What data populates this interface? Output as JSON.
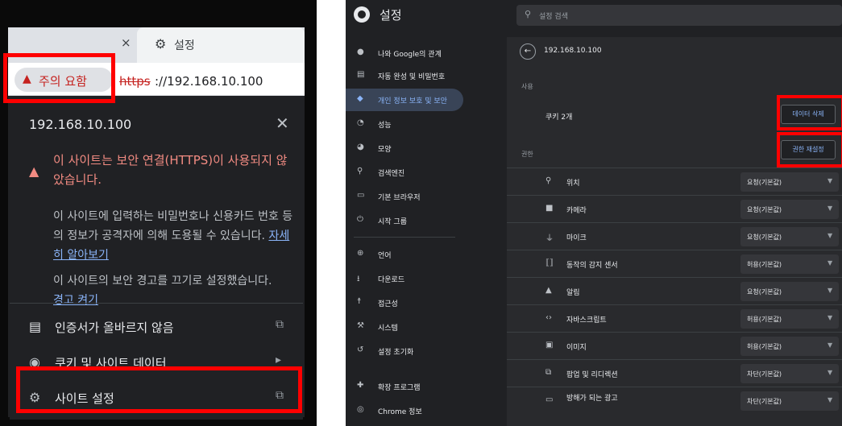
{
  "left": {
    "tab": {
      "close_glyph": "×",
      "settings_label": "설정"
    },
    "address": {
      "warning_chip": "주의 요함",
      "url_scheme": "https",
      "url_rest": "://192.168.10.100"
    },
    "popup": {
      "host": "192.168.10.100",
      "warning_title": "이 사이트는 보안 연결(HTTPS)이 사용되지 않았습니다.",
      "warning_body": "이 사이트에 입력하는 비밀번호나 신용카드 번호 등의 정보가 공격자에 의해 도용될 수 있습니다.",
      "learn_more": "자세히 알아보기",
      "note": "이 사이트의 보안 경고를 끄기로 설정했습니다.",
      "turn_on_warnings": "경고 켜기",
      "rows": [
        {
          "icon": "certificate-icon",
          "label": "인증서가 올바르지 않음",
          "trail": "external-link-icon"
        },
        {
          "icon": "cookie-icon",
          "label": "쿠키 및 사이트 데이터",
          "trail": "chevron-right-icon"
        },
        {
          "icon": "gear-icon",
          "label": "사이트 설정",
          "trail": "external-link-icon"
        }
      ]
    }
  },
  "right": {
    "title": "설정",
    "search_placeholder": "설정 검색",
    "sidebar": [
      {
        "icon": "person-icon",
        "label": "나와 Google의 관계"
      },
      {
        "icon": "autofill-icon",
        "label": "자동 완성 및 비밀번호"
      },
      {
        "icon": "shield-icon",
        "label": "개인 정보 보호 및 보안",
        "active": true
      },
      {
        "icon": "speedometer-icon",
        "label": "성능"
      },
      {
        "icon": "palette-icon",
        "label": "모양"
      },
      {
        "icon": "search-icon",
        "label": "검색엔진"
      },
      {
        "icon": "browser-icon",
        "label": "기본 브라우저"
      },
      {
        "icon": "power-icon",
        "label": "시작 그룹"
      },
      {
        "icon": "globe-icon",
        "label": "언어"
      },
      {
        "icon": "download-icon",
        "label": "다운로드"
      },
      {
        "icon": "accessibility-icon",
        "label": "접근성"
      },
      {
        "icon": "wrench-icon",
        "label": "시스템"
      },
      {
        "icon": "reset-icon",
        "label": "설정 초기화"
      },
      {
        "icon": "puzzle-icon",
        "label": "확장 프로그램"
      },
      {
        "icon": "chrome-icon",
        "label": "Chrome 정보"
      }
    ],
    "main": {
      "host": "192.168.10.100",
      "usage_heading": "사용",
      "cookies_label": "쿠키 2개",
      "clear_data_button": "데이터 삭제",
      "permissions_heading": "권한",
      "reset_permissions_button": "권한 재설정",
      "permissions": [
        {
          "icon": "location-icon",
          "label": "위치",
          "value": "요청(기본값)"
        },
        {
          "icon": "camera-icon",
          "label": "카메라",
          "value": "요청(기본값)"
        },
        {
          "icon": "microphone-icon",
          "label": "마이크",
          "value": "요청(기본값)"
        },
        {
          "icon": "motion-sensor-icon",
          "label": "동작의 감지 센서",
          "value": "허용(기본값)"
        },
        {
          "icon": "bell-icon",
          "label": "알림",
          "value": "요청(기본값)"
        },
        {
          "icon": "code-icon",
          "label": "자바스크립트",
          "value": "허용(기본값)"
        },
        {
          "icon": "image-icon",
          "label": "이미지",
          "value": "허용(기본값)"
        },
        {
          "icon": "popup-icon",
          "label": "팝업 및 리디렉션",
          "value": "차단(기본값)"
        },
        {
          "icon": "ads-icon",
          "label": "방해가 되는 광고",
          "value": "차단(기본값)"
        }
      ]
    }
  },
  "colors": {
    "highlight_box": "#ff0000",
    "warning": "#c5221f",
    "link": "#8ab4f8"
  }
}
